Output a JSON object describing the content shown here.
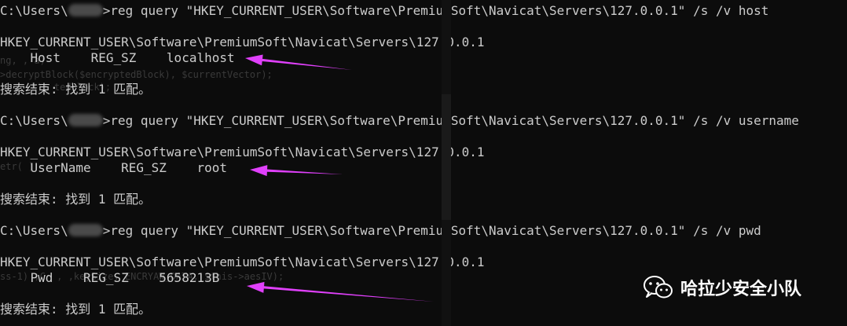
{
  "terminal": {
    "ghost_lines": [
      "ng, , a)",
      ">decryptBlock($encryptedBlock), $currentVector);",
      "k); tedBlock);",
      "etr( )",
      "ss-1) ,C  , ,keySize, ENCRYAW_DATA, $this->aesIV);"
    ],
    "blocks": [
      {
        "prompt_prefix": "C:\\Users\\",
        "command": ">reg query \"HKEY_CURRENT_USER\\Software\\PremiumSoft\\Navicat\\Servers\\127.0.0.1\" /s /v host",
        "key_path": "HKEY_CURRENT_USER\\Software\\PremiumSoft\\Navicat\\Servers\\127.0.0.1",
        "value_line": "    Host    REG_SZ    localhost",
        "result": "搜索结束: 找到 1 匹配。"
      },
      {
        "prompt_prefix": "C:\\Users\\",
        "command": ">reg query \"HKEY_CURRENT_USER\\Software\\PremiumSoft\\Navicat\\Servers\\127.0.0.1\" /s /v username",
        "key_path": "HKEY_CURRENT_USER\\Software\\PremiumSoft\\Navicat\\Servers\\127.0.0.1",
        "value_line": "    UserName    REG_SZ    root",
        "result": "搜索结束: 找到 1 匹配。"
      },
      {
        "prompt_prefix": "C:\\Users\\",
        "command": ">reg query \"HKEY_CURRENT_USER\\Software\\PremiumSoft\\Navicat\\Servers\\127.0.0.1\" /s /v pwd",
        "key_path": "HKEY_CURRENT_USER\\Software\\PremiumSoft\\Navicat\\Servers\\127.0.0.1",
        "value_line": "    Pwd    REG_SZ    5658213B",
        "result": "搜索结束: 找到 1 匹配。"
      }
    ]
  },
  "annotation": {
    "arrow_color": "#e040fb"
  },
  "watermark": {
    "text": "哈拉少安全小队",
    "icon": "wechat-icon"
  }
}
